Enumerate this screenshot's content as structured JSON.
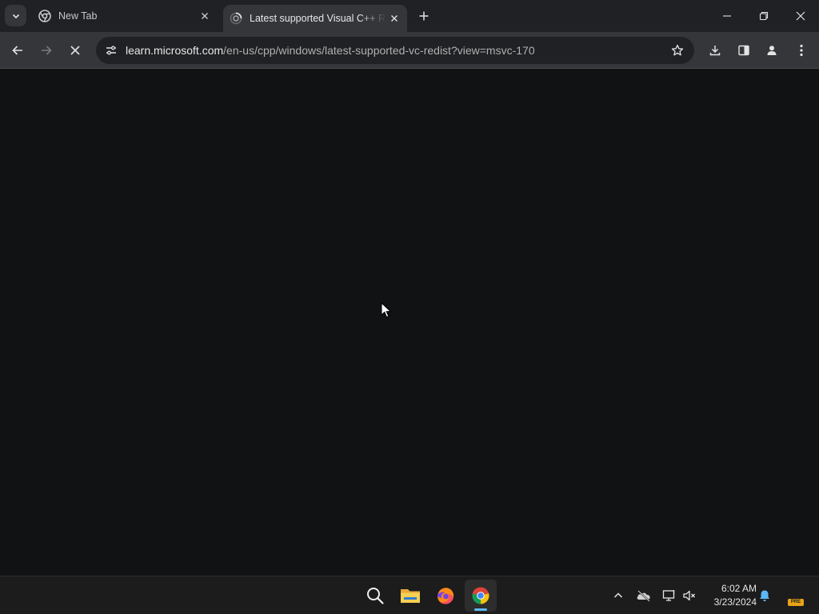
{
  "tabs": [
    {
      "title": "New Tab",
      "icon": "chrome-icon",
      "active": false
    },
    {
      "title": "Latest supported Visual C++ Redistributable downloads",
      "icon": "loading-spinner-icon",
      "active": true
    }
  ],
  "address_bar": {
    "host": "learn.microsoft.com",
    "path": "/en-us/cpp/windows/latest-supported-vc-redist?view=msvc-170"
  },
  "toolbar_icons": [
    "back-arrow-icon",
    "forward-arrow-icon",
    "stop-loading-icon",
    "site-info-icon",
    "bookmark-star-icon",
    "download-icon",
    "side-panel-icon",
    "profile-icon",
    "kebab-menu-icon"
  ],
  "window_controls": [
    "minimize-icon",
    "restore-icon",
    "close-icon"
  ],
  "taskbar": {
    "apps": [
      "search-icon",
      "file-explorer-icon",
      "firefox-icon",
      "chrome-icon"
    ],
    "active_app": "chrome-icon",
    "tray_icons": [
      "chevron-up-icon",
      "onedrive-offline-icon",
      "network-icon",
      "volume-muted-icon",
      "notification-bell-icon"
    ],
    "time": "6:02 AM",
    "date": "3/23/2024",
    "badge": "PRE"
  },
  "colors": {
    "titlebar": "#202124",
    "toolbar": "#35363a",
    "omnibox": "#202124",
    "content": "#111213",
    "taskbar": "#1c1c1c",
    "accent": "#5cb8f5"
  }
}
